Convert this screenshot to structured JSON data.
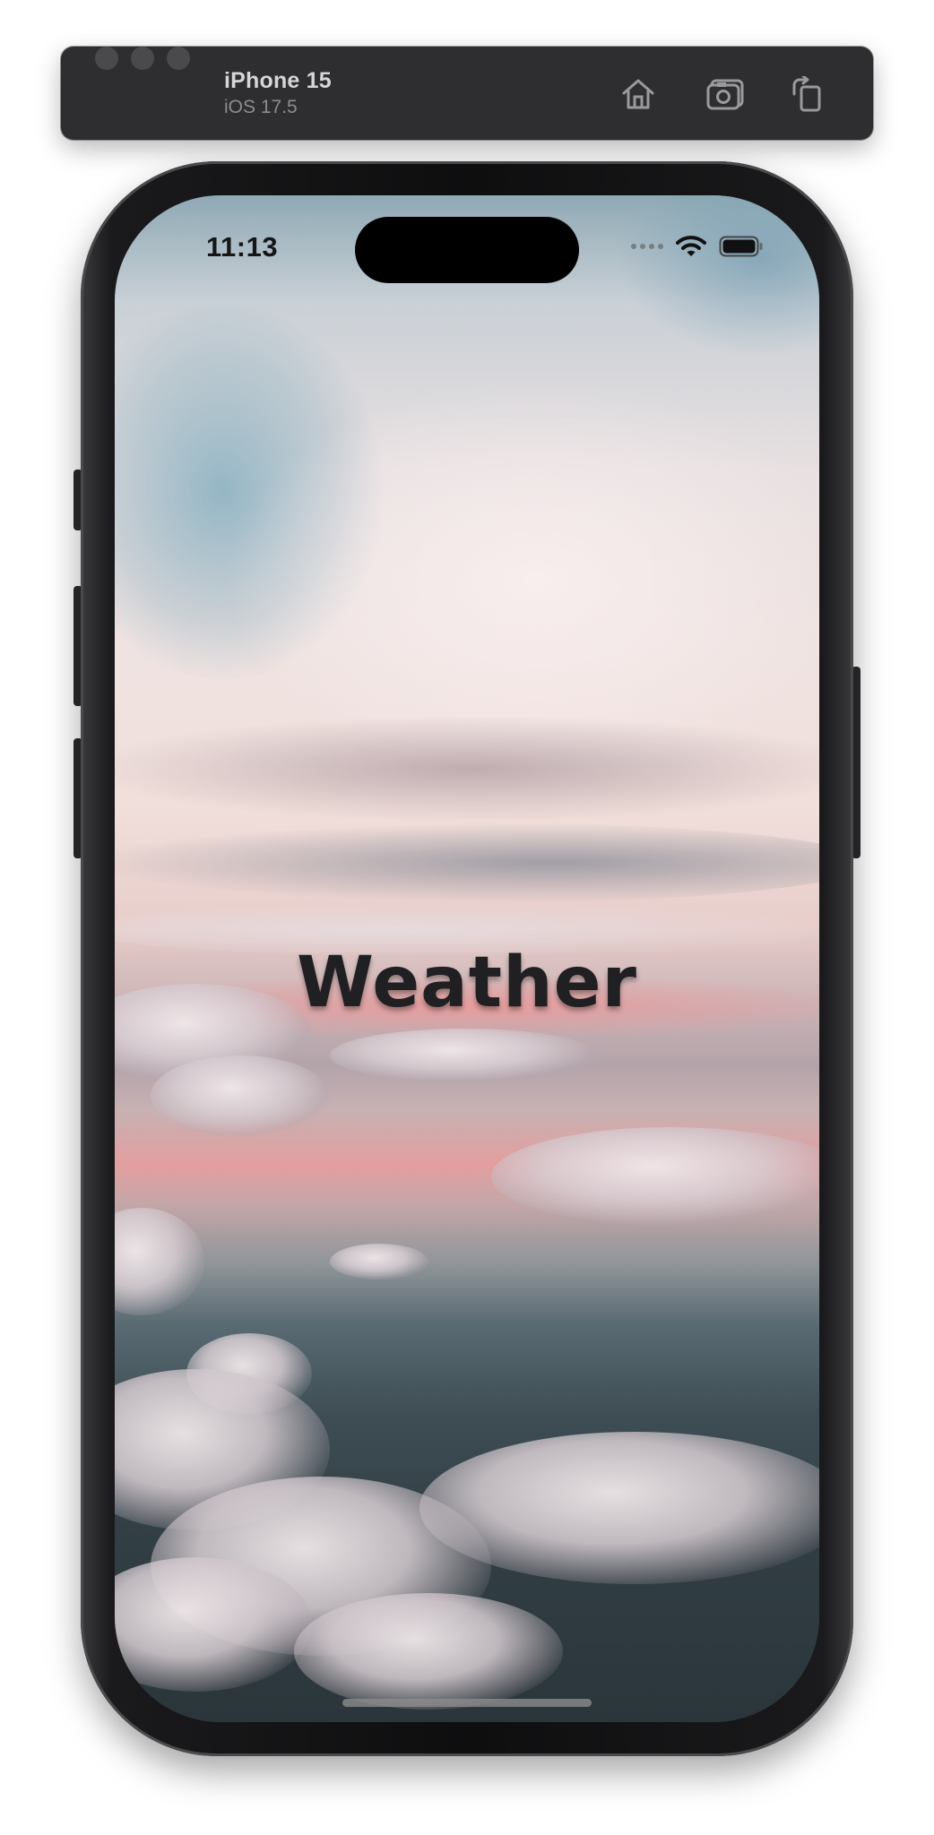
{
  "toolbar": {
    "device_name": "iPhone 15",
    "os_version": "iOS 17.5",
    "buttons": {
      "home": "home-icon",
      "screenshot": "camera-icon",
      "rotate": "rotate-icon"
    }
  },
  "status_bar": {
    "time": "11:13",
    "icons": [
      "cellular-signal-icon",
      "wifi-icon",
      "battery-icon"
    ]
  },
  "app": {
    "title": "Weather",
    "background": "sky-clouds-photo",
    "title_color": "#201f22"
  }
}
